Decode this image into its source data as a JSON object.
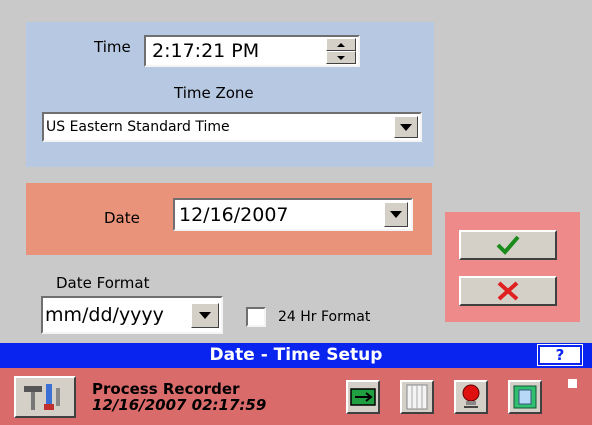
{
  "time_section": {
    "time_label": "Time",
    "time_value": "2:17:21 PM",
    "time_zone_label": "Time Zone",
    "time_zone_value": "US Eastern Standard Time"
  },
  "date_section": {
    "date_label": "Date",
    "date_value": "12/16/2007"
  },
  "format_section": {
    "date_format_label": "Date Format",
    "date_format_value": "mm/dd/yyyy",
    "hr24_label": "24 Hr Format",
    "hr24_checked": false
  },
  "actions": {
    "ok_icon": "check-icon",
    "cancel_icon": "x-icon"
  },
  "title_bar": {
    "title": "Date - Time Setup",
    "help_label": "?"
  },
  "status_bar": {
    "app_name": "Process Recorder",
    "datetime": "12/16/2007 02:17:59"
  },
  "colors": {
    "time_panel": "#b7c9e2",
    "date_panel": "#e9937a",
    "action_panel": "#ef8a8a",
    "title_bar": "#0a24f0",
    "status_bar": "#d96b6b",
    "check": "#1a8a1a",
    "cross": "#e02020"
  }
}
